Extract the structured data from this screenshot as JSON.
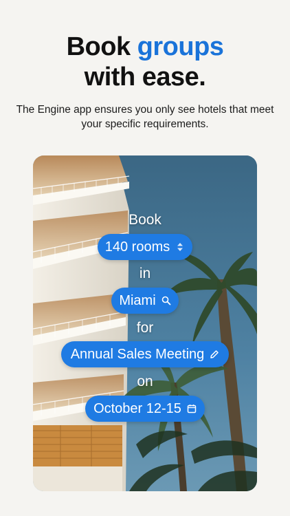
{
  "hero": {
    "headline_part1": "Book",
    "headline_accent": "groups",
    "headline_part2": "with ease.",
    "subtitle": "The Engine app ensures you only see hotels that meet your specific requirements."
  },
  "booking_sentence": {
    "word_book": "Book",
    "rooms_value": "140 rooms",
    "word_in": "in",
    "location_value": "Miami",
    "word_for": "for",
    "event_value": "Annual Sales Meeting",
    "word_on": "on",
    "dates_value": "October 12-15"
  },
  "icons": {
    "rooms": "stepper-arrows-icon",
    "location": "search-icon",
    "event": "pencil-icon",
    "dates": "calendar-icon"
  },
  "colors": {
    "accent": "#1a73d9",
    "pill": "#1f7be3",
    "background": "#f5f4f1"
  }
}
